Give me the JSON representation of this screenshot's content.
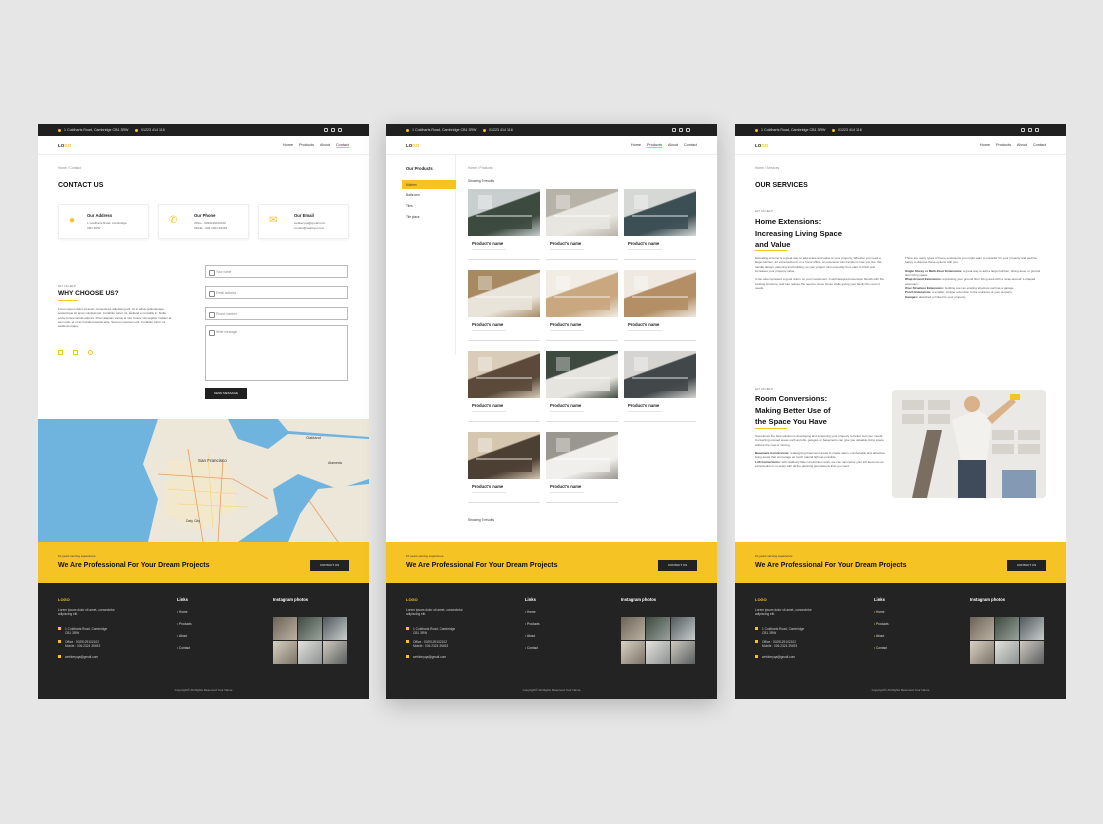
{
  "common": {
    "address": "1 Coldharts Road, Cambridge CB1 3RW",
    "phone": "01223 414 116",
    "logo_a": "LO",
    "logo_b": "GO",
    "menu": [
      "Home",
      "Products",
      "About",
      "Contact"
    ],
    "cta_small": "10 years serving experience",
    "cta_big": "We Are Professional For Your Dream Projects",
    "cta_button": "CONTACT US",
    "footer_logo": "LOGO",
    "footer_about": "Lorem ipsum dolor sit amet, consectetur adipiscing elit.",
    "footer_address_1": "1 Coldharts Road, Cambridge",
    "footer_address_2": "CB1 3RW",
    "footer_office": "Office : 0029129102102",
    "footer_mobile": "Mobile : 006 2324 39493",
    "footer_email": "webkeryqa@gmail.com",
    "links_title": "Links",
    "links": [
      "Home",
      "Products",
      "About",
      "Contact"
    ],
    "instagram_title": "Instagram photos",
    "copyright": "Copyright© All Rights Reserved Your Name"
  },
  "contact": {
    "breadcrumb": "Home / Contact",
    "title": "CONTACT US",
    "address_title": "Our Address",
    "address_line1": "1 Coldharts Road, Cambridge",
    "address_line2": "CB1 3RW",
    "phone_title": "Our Phone",
    "phone_office": "Office : 0029129102102",
    "phone_mobile": "Mobile : 006 2324 39493",
    "email_title": "Our Email",
    "email_1": "webkeryqa@gmail.com",
    "email_2": "contact@webkyer.com",
    "why_tag": "LET US HELP",
    "why_title": "WHY CHOOSE US?",
    "why_text": "Lorem ipsum dolor sit amet, consectetur adipiscing elit. Ut in tellus pellentesque, scelerisque sit amet volutpat nisi. Curabitur tortor mi, eleifend a convallis in. Nulla porta cursus iaculis ultrices. Proin aliquam varius at nisl. Fusce nisl sagittis. Nullam at sem odio, et ut ac tincidunt iaculis ante. Sed eu maximum elit. Curabitur tortor mi, eleifend ornare.",
    "name_placeholder": "Your name",
    "email_placeholder": "Email address",
    "phone_placeholder": "Phone number",
    "message_placeholder": "Write message",
    "send_label": "SEND MESSAGE"
  },
  "products": {
    "sidebar_title": "Our Products",
    "categories": [
      "Kitchen",
      "Bathroom",
      "Tiles",
      "Tile place"
    ],
    "breadcrumb": "Home / Products",
    "showing_top": "Showing 9 results",
    "showing_bottom": "Showing 9 results",
    "product_name": "Product's name",
    "items": [
      {
        "color1": "#3d4a3f",
        "color2": "#c9cfcf"
      },
      {
        "color1": "#e8e6e1",
        "color2": "#b8b3a8"
      },
      {
        "color1": "#3c4f54",
        "color2": "#d6d8d6"
      },
      {
        "color1": "#e9e4da",
        "color2": "#a78a62"
      },
      {
        "color1": "#c9a77f",
        "color2": "#f1ece4"
      },
      {
        "color1": "#b48e65",
        "color2": "#efe9e2"
      },
      {
        "color1": "#5b4a3a",
        "color2": "#d9cdb9"
      },
      {
        "color1": "#e6e4de",
        "color2": "#3e4a40"
      },
      {
        "color1": "#42474a",
        "color2": "#d5d4d1"
      },
      {
        "color1": "#4c3f33",
        "color2": "#d4c6af"
      },
      {
        "color1": "#f0efeb",
        "color2": "#9a9690"
      }
    ]
  },
  "services": {
    "breadcrumb": "Home / Services",
    "title": "OUR SERVICES",
    "s1_tag": "LET US HELP",
    "s1_title_1": "Home Extensions:",
    "s1_title_2": "Increasing Living Space",
    "s1_title_3": "and Value",
    "s1_text": "Extending a home is a great way to add space and value to your property. Whether you need a larger kitchen, an extra bedroom or a home office, an extension can transform how you live. We handle design, planning and building, so your project runs smoothly from start to finish and increases your property value.",
    "s1_text_2": "It can also represent a good return on your investment. A well designed extension blends with the existing structure, and can reduce the need to move house while giving your family the room it needs.",
    "s1_right": "There are many types of home extensions you might want to consider for your property and we'll be happy to discuss these options with you.",
    "s1_item1_label": "Single Storey or Multi-Floor Extensions:",
    "s1_item1": " a great way to add a larger kitchen, dining area, or ground floor living space.",
    "s1_item2_label": "Wrap Around Extensions:",
    "s1_item2": " expanding your ground floor living area with a 'wrap-around' L-shaped extension.",
    "s1_item3_label": "Over Structure Extensions:",
    "s1_item3": " building over an existing structure such as a garage.",
    "s1_item4_label": "Porch Extensions:",
    "s1_item4": " a smaller, simpler extension to the entrance of your property.",
    "s1_item5_label": "Garages:",
    "s1_item5": " detached or linked to your property.",
    "s2_tag": "LET US HELP",
    "s2_title_1": "Room Conversions:",
    "s2_title_2": "Making Better Use of",
    "s2_title_3": "the Space You Have",
    "s2_text": "Sometimes the best solution is developing and improving your property to better suit your needs. Converting unused areas such as lofts, garages or basements can give you valuable living space without the cost of moving.",
    "s2_item1_label": "Basement Conversions:",
    "s2_item1": " redesigning basement areas to create warm, comfortable and attractive living areas that encourage as much natural light as possible.",
    "s2_item2_label": "Loft Conversions:",
    "s2_item2": " with relatively little construction work, we can repurpose your loft area into an extra bedroom or study with all the planning permissions that you need."
  }
}
